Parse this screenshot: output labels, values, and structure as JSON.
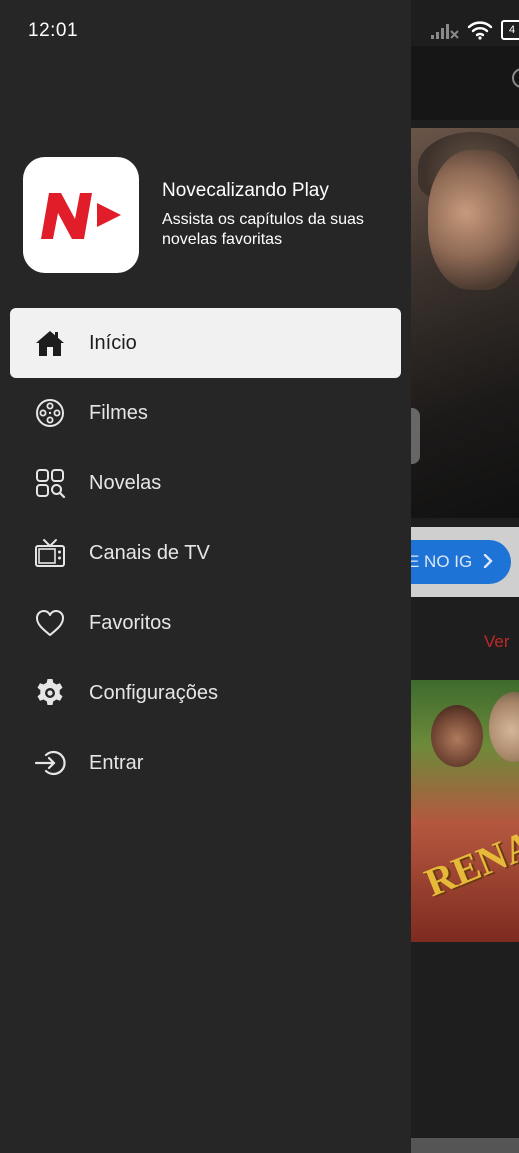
{
  "status_bar": {
    "time": "12:01",
    "battery": "4",
    "icons": [
      "signal-icon",
      "wifi-icon",
      "battery-icon"
    ]
  },
  "drawer": {
    "app_name": "Novecalizando Play",
    "app_subtitle": "Assista os capítulos da suas novelas favoritas",
    "logo_icon": "novecalizando-logo-icon",
    "menu": [
      {
        "label": "Início",
        "icon": "home-icon",
        "active": true
      },
      {
        "label": "Filmes",
        "icon": "film-reel-icon",
        "active": false
      },
      {
        "label": "Novelas",
        "icon": "grid-search-icon",
        "active": false
      },
      {
        "label": "Canais de TV",
        "icon": "tv-icon",
        "active": false
      },
      {
        "label": "Favoritos",
        "icon": "heart-icon",
        "active": false
      },
      {
        "label": "Configurações",
        "icon": "gear-icon",
        "active": false
      },
      {
        "label": "Entrar",
        "icon": "sign-in-icon",
        "active": false
      }
    ]
  },
  "background": {
    "ig_button_label": "E NO IG",
    "ver_link": "Ver",
    "poster_title": "RENASC"
  },
  "colors": {
    "drawer_bg": "#262626",
    "active_item_bg": "#f1f1f1",
    "brand_red": "#e11d2a",
    "link_red": "#c0282a",
    "ig_button_blue": "#1e73d6"
  }
}
